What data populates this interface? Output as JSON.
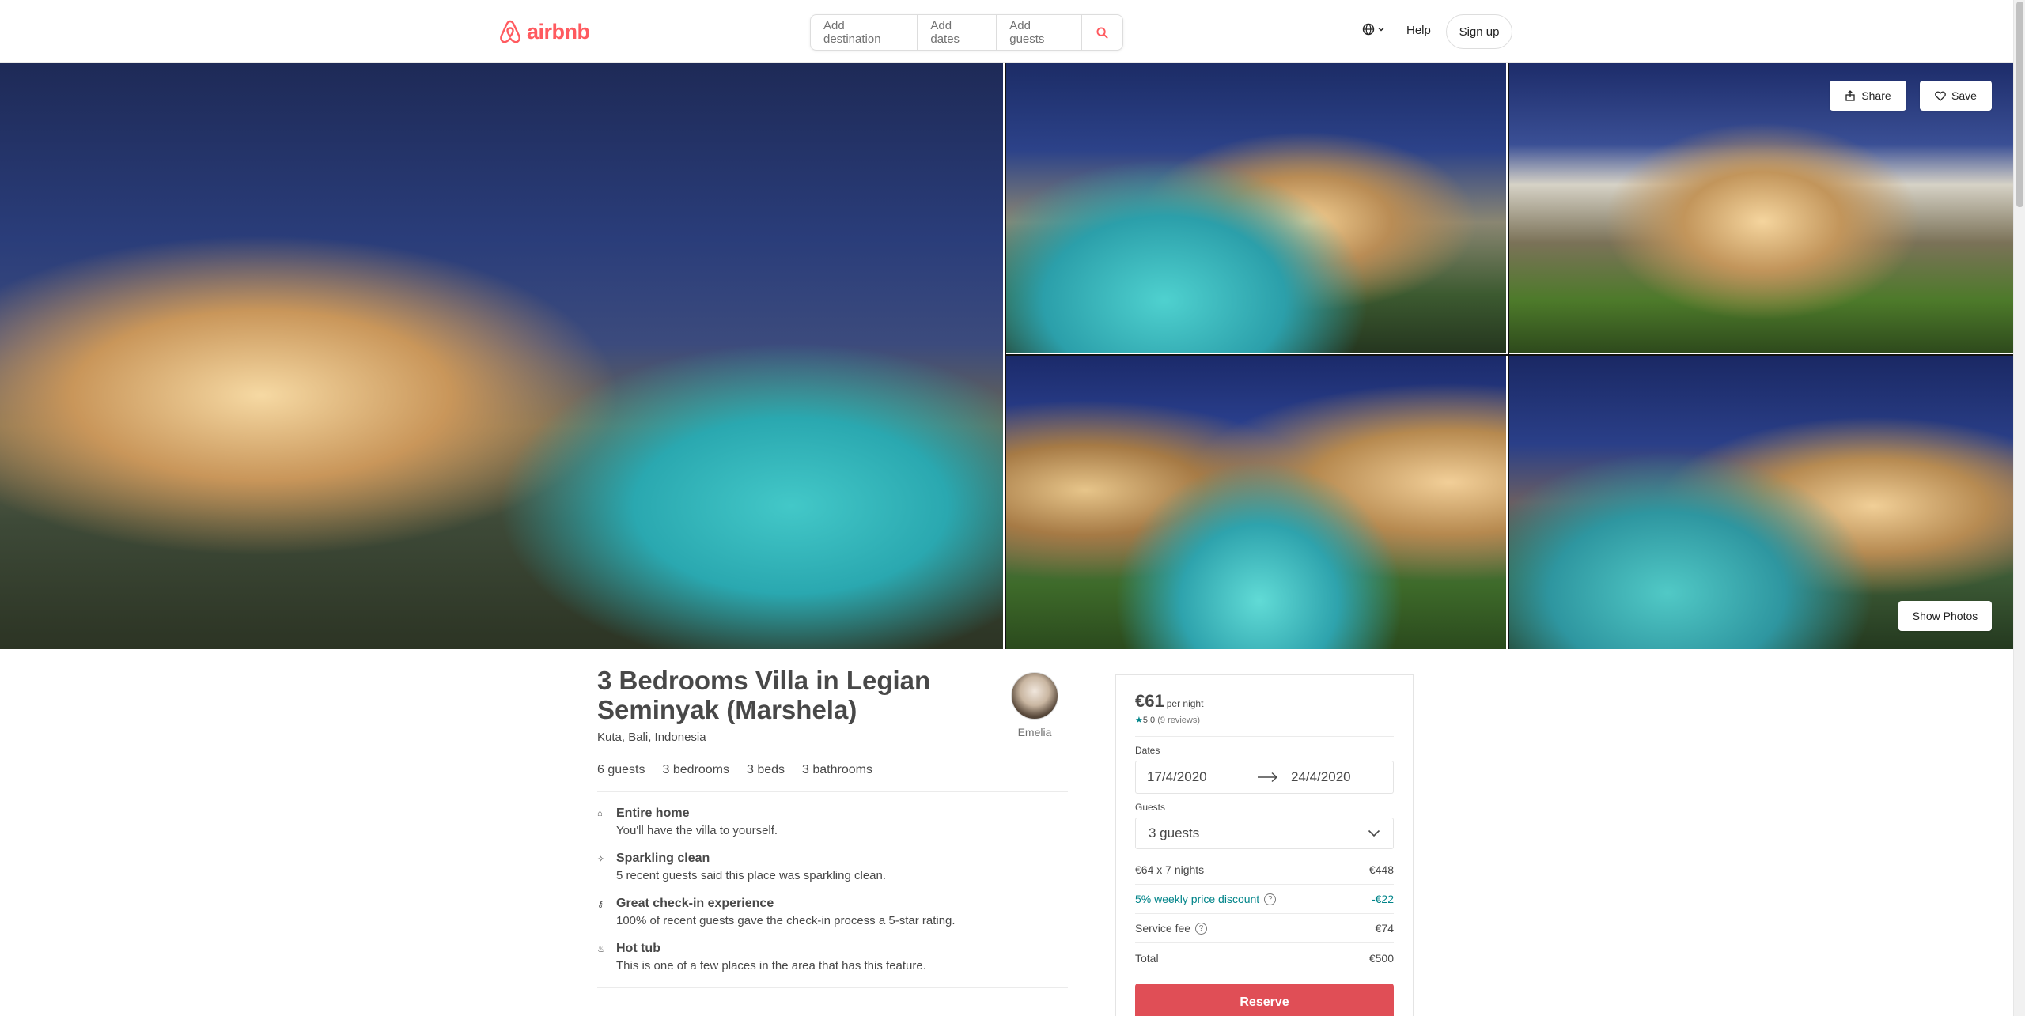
{
  "header": {
    "logo_text": "airbnb",
    "search": {
      "destination": "Add destination",
      "dates": "Add dates",
      "guests": "Add guests"
    },
    "help": "Help",
    "signup": "Sign up"
  },
  "gallery": {
    "share": "Share",
    "save": "Save",
    "show_photos": "Show Photos"
  },
  "listing": {
    "title": "3 Bedrooms Villa in Legian Seminyak (Marshela)",
    "location": "Kuta, Bali, Indonesia",
    "host_name": "Emelia",
    "stats": [
      "6 guests",
      "3 bedrooms",
      "3 beds",
      "3 bathrooms"
    ],
    "features": [
      {
        "icon": "home-icon",
        "title": "Entire home",
        "desc": "You'll have the villa to yourself."
      },
      {
        "icon": "sparkle-icon",
        "title": "Sparkling clean",
        "desc": "5 recent guests said this place was sparkling clean."
      },
      {
        "icon": "key-icon",
        "title": "Great check-in experience",
        "desc": "100% of recent guests gave the check-in process a 5-star rating."
      },
      {
        "icon": "hot-tub-icon",
        "title": "Hot tub",
        "desc": "This is one of a few places in the area that has this feature."
      }
    ]
  },
  "booking": {
    "price": "€61",
    "per_night": "per night",
    "rating_star": "★",
    "rating": "5.0",
    "reviews": "(9 reviews)",
    "dates_label": "Dates",
    "checkin": "17/4/2020",
    "checkout": "24/4/2020",
    "guests_label": "Guests",
    "guests_value": "3 guests",
    "nights_label": "€64 x 7 nights",
    "nights_value": "€448",
    "discount_label": "5% weekly price discount",
    "discount_value": "-€22",
    "service_label": "Service fee",
    "service_value": "€74",
    "total_label": "Total",
    "total_value": "€500",
    "reserve": "Reserve",
    "accent_color": "#e04e56",
    "link_color": "#008489"
  }
}
